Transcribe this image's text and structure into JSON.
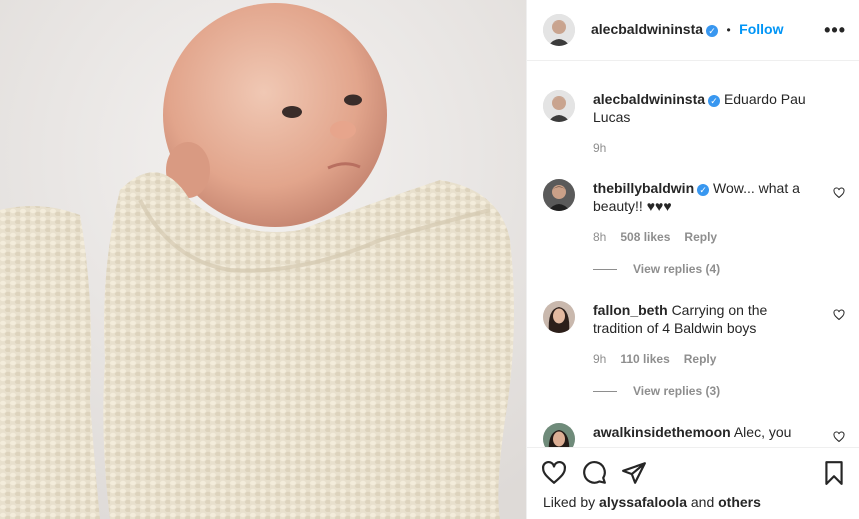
{
  "post": {
    "username": "alecbaldwininsta",
    "follow_label": "Follow",
    "dot": "•",
    "more": "•••",
    "caption": "Eduardo Pau Lucas",
    "caption_time": "9h"
  },
  "comments": [
    {
      "username": "thebillybaldwin",
      "verified": true,
      "text": "Wow... what a beauty!! ♥♥♥",
      "time": "8h",
      "likes": "508 likes",
      "reply": "Reply",
      "view_replies": "View replies (4)"
    },
    {
      "username": "fallon_beth",
      "verified": false,
      "text": "Carrying on the tradition of 4 Baldwin boys",
      "time": "9h",
      "likes": "110 likes",
      "reply": "Reply",
      "view_replies": "View replies (3)"
    },
    {
      "username": "awalkinsidethemoon",
      "verified": false,
      "text": "Alec, you"
    }
  ],
  "footer": {
    "liked_prefix": "Liked by",
    "liked_user": "alyssafaloola",
    "liked_and": "and",
    "liked_others": "others"
  },
  "icons": {
    "like": "heart-icon",
    "comment": "comment-icon",
    "share": "paper-plane-icon",
    "save": "bookmark-icon"
  }
}
